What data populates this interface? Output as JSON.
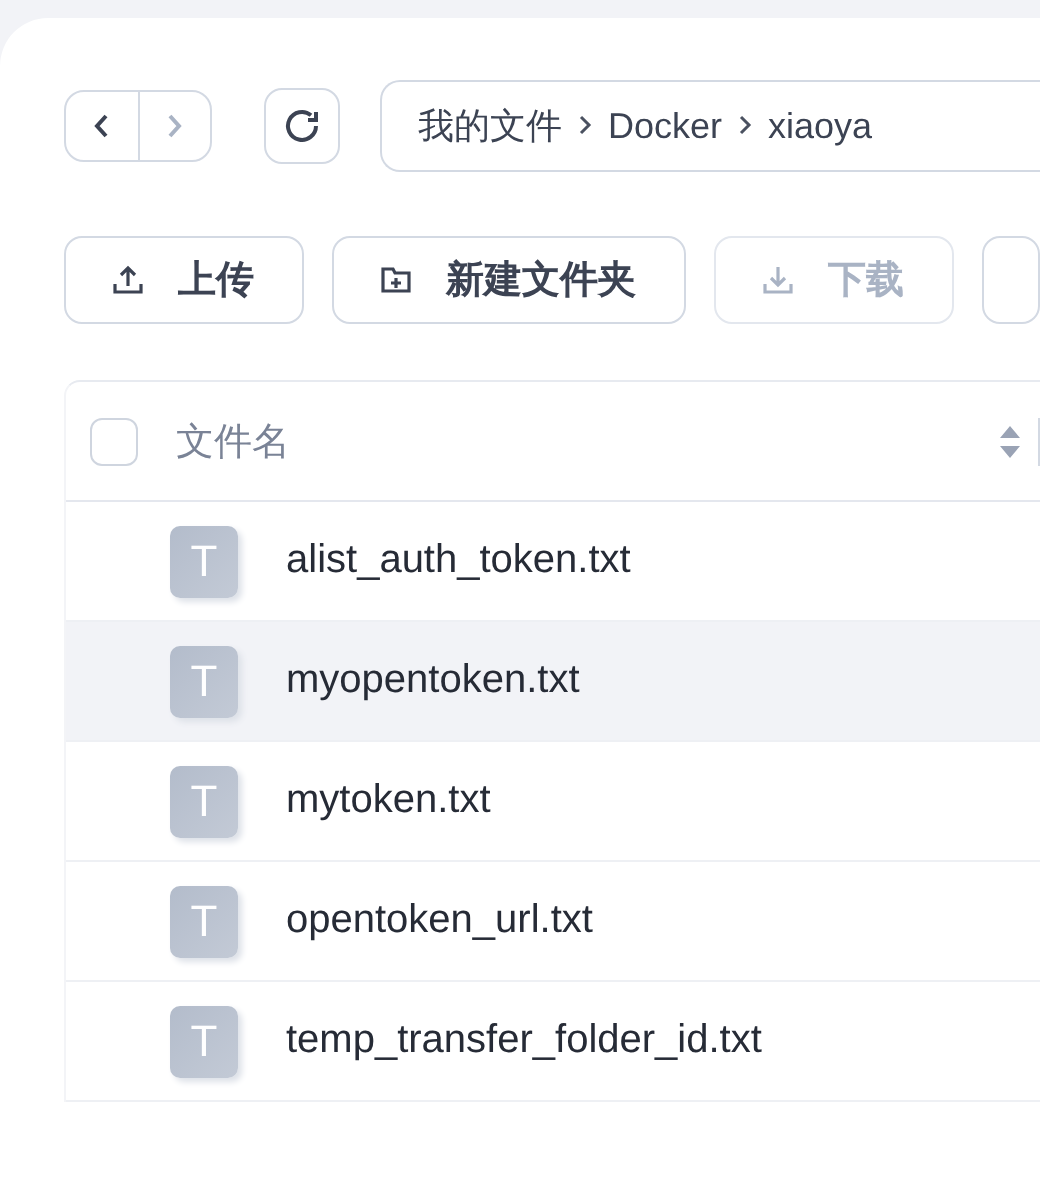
{
  "breadcrumb": [
    {
      "label": "我的文件"
    },
    {
      "label": "Docker"
    },
    {
      "label": "xiaoya"
    }
  ],
  "toolbar": [
    {
      "kind": "upload",
      "label": "上传",
      "disabled": false
    },
    {
      "kind": "new-folder",
      "label": "新建文件夹",
      "disabled": false
    },
    {
      "kind": "download",
      "label": "下载",
      "disabled": true
    },
    {
      "kind": "more"
    }
  ],
  "table": {
    "select_all": {
      "checked": false
    },
    "columns": [
      {
        "label": "文件名"
      }
    ],
    "rows": [
      {
        "name": "alist_auth_token.txt",
        "icon_letter": "T",
        "highlighted": false
      },
      {
        "name": "myopentoken.txt",
        "icon_letter": "T",
        "highlighted": true
      },
      {
        "name": "mytoken.txt",
        "icon_letter": "T",
        "highlighted": false
      },
      {
        "name": "opentoken_url.txt",
        "icon_letter": "T",
        "highlighted": false
      },
      {
        "name": "temp_transfer_folder_id.txt",
        "icon_letter": "T",
        "highlighted": false
      }
    ]
  }
}
